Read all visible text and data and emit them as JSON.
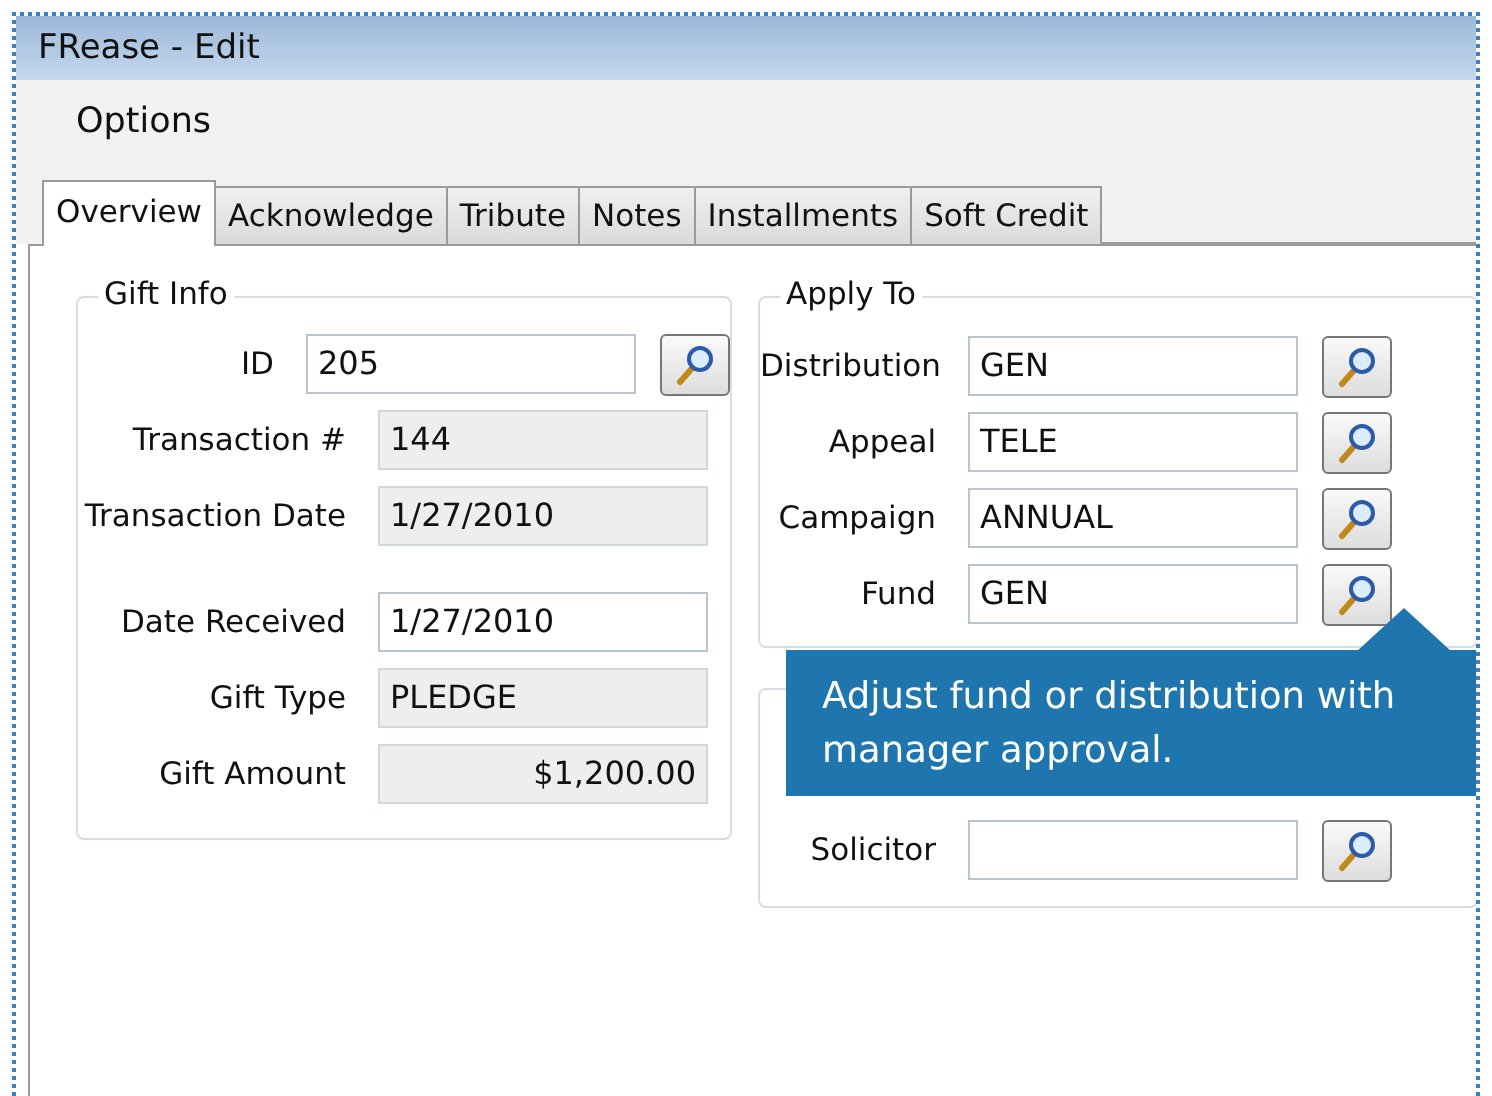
{
  "window": {
    "title": "FRease - Edit"
  },
  "menu": [
    "Options"
  ],
  "tabs": [
    {
      "label": "Overview",
      "selected": true
    },
    {
      "label": "Acknowledge",
      "selected": false
    },
    {
      "label": "Tribute",
      "selected": false
    },
    {
      "label": "Notes",
      "selected": false
    },
    {
      "label": "Installments",
      "selected": false
    },
    {
      "label": "Soft Credit",
      "selected": false
    }
  ],
  "gift_info": {
    "title": "Gift Info",
    "sections": [
      [
        {
          "label": "ID",
          "value": "205",
          "kind": "lookup"
        },
        {
          "label": "Transaction #",
          "value": "144",
          "kind": "readonly"
        },
        {
          "label": "Transaction Date",
          "value": "1/27/2010",
          "kind": "readonly"
        }
      ],
      [
        {
          "label": "Date Received",
          "value": "1/27/2010",
          "kind": "editable"
        },
        {
          "label": "Gift Type",
          "value": "PLEDGE",
          "kind": "readonly"
        },
        {
          "label": "Gift Amount",
          "value": "$1,200.00",
          "kind": "amount"
        }
      ]
    ]
  },
  "apply_to": {
    "title": "Apply To",
    "fields": [
      {
        "label": "Distribution",
        "value": "GEN"
      },
      {
        "label": "Appeal",
        "value": "TELE"
      },
      {
        "label": "Campaign",
        "value": "ANNUAL"
      },
      {
        "label": "Fund",
        "value": "GEN"
      }
    ]
  },
  "lower_group": {
    "rows": [
      {
        "kind": "covered"
      },
      {
        "kind": "lookup",
        "label": "Solicitor"
      }
    ]
  },
  "tooltip": {
    "text": "Adjust fund or distribution with manager approval."
  }
}
